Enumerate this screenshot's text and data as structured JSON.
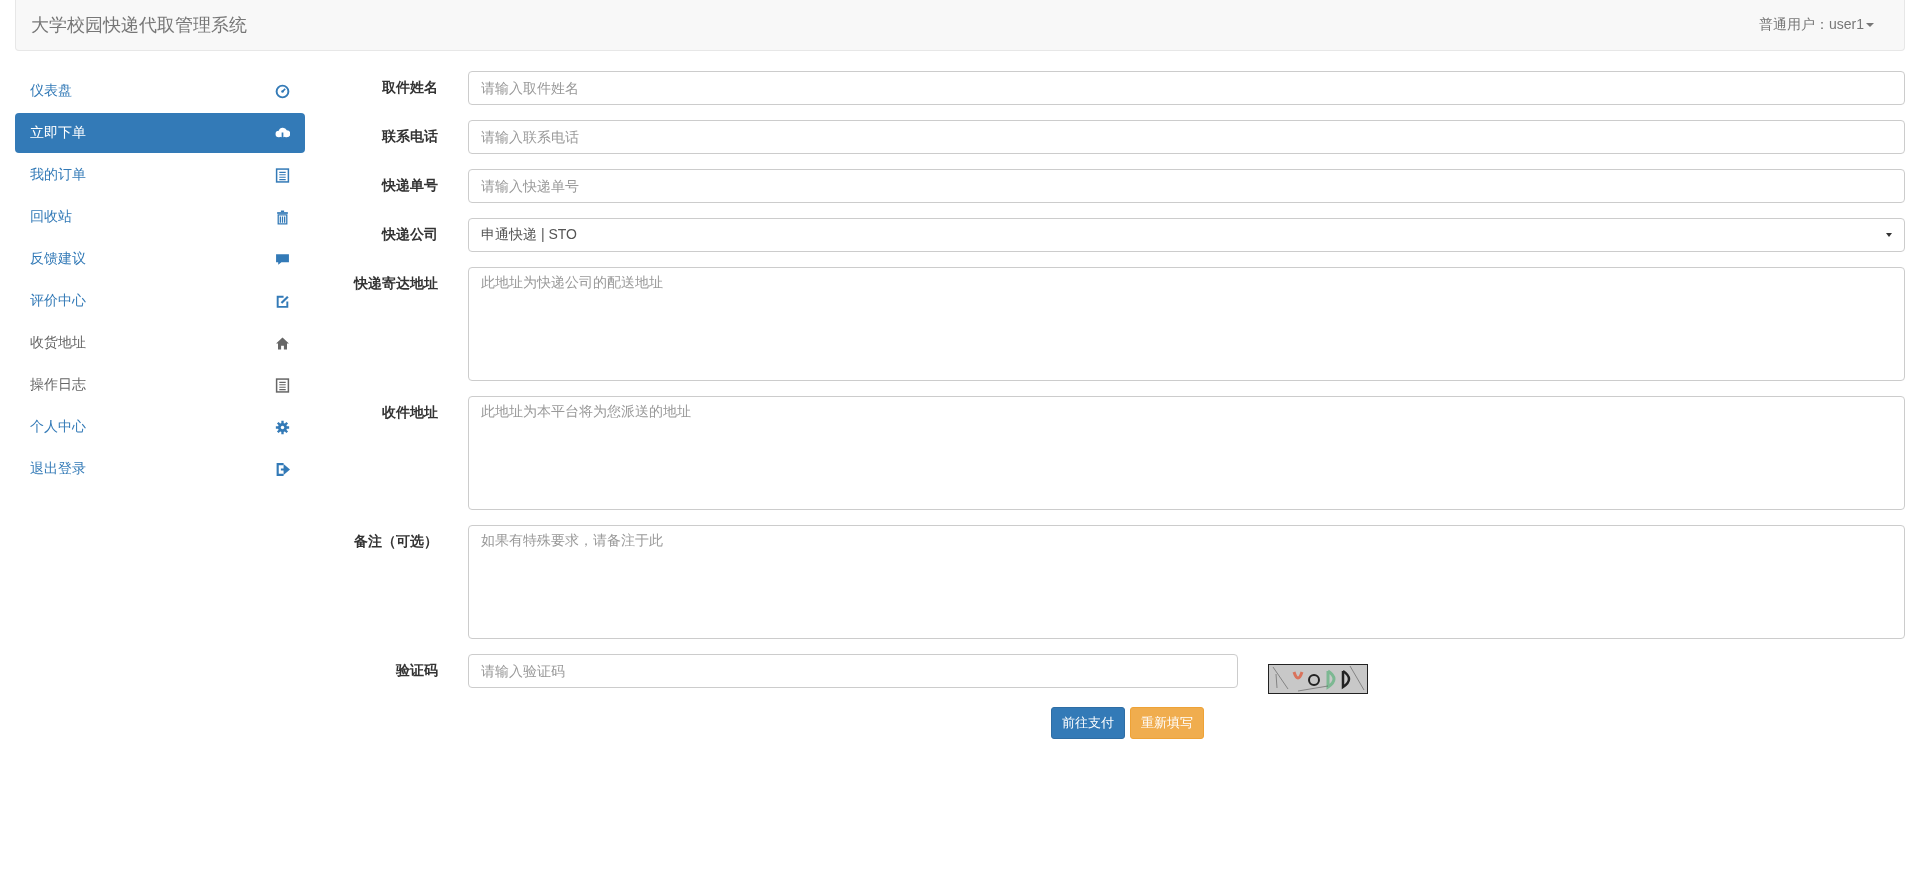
{
  "navbar": {
    "title": "大学校园快递代取管理系统",
    "user_menu": "普通用户：user1"
  },
  "sidebar": {
    "items": [
      {
        "label": "仪表盘",
        "selected": false,
        "visited": false
      },
      {
        "label": "立即下单",
        "selected": true,
        "visited": false
      },
      {
        "label": "我的订单",
        "selected": false,
        "visited": false
      },
      {
        "label": "回收站",
        "selected": false,
        "visited": false
      },
      {
        "label": "反馈建议",
        "selected": false,
        "visited": false
      },
      {
        "label": "评价中心",
        "selected": false,
        "visited": false
      },
      {
        "label": "收货地址",
        "selected": false,
        "visited": true
      },
      {
        "label": "操作日志",
        "selected": false,
        "visited": true
      },
      {
        "label": "个人中心",
        "selected": false,
        "visited": false
      },
      {
        "label": "退出登录",
        "selected": false,
        "visited": false
      }
    ]
  },
  "form": {
    "fields": [
      {
        "kind": "input",
        "label": "取件姓名",
        "placeholder": "请输入取件姓名"
      },
      {
        "kind": "input",
        "label": "联系电话",
        "placeholder": "请输入联系电话"
      },
      {
        "kind": "input",
        "label": "快递单号",
        "placeholder": "请输入快递单号"
      },
      {
        "kind": "select",
        "label": "快递公司",
        "value": "申通快递 | STO"
      },
      {
        "kind": "textarea",
        "label": "快递寄达地址",
        "placeholder": "此地址为快递公司的配送地址"
      },
      {
        "kind": "textarea",
        "label": "收件地址",
        "placeholder": "此地址为本平台将为您派送的地址"
      },
      {
        "kind": "textarea",
        "label": "备注（可选）",
        "placeholder": "如果有特殊要求，请备注于此"
      },
      {
        "kind": "captcha",
        "label": "验证码",
        "placeholder": "请输入验证码"
      }
    ],
    "buttons": [
      {
        "label": "前往支付",
        "kind": "primary"
      },
      {
        "label": "重新填写",
        "kind": "warning"
      }
    ]
  }
}
